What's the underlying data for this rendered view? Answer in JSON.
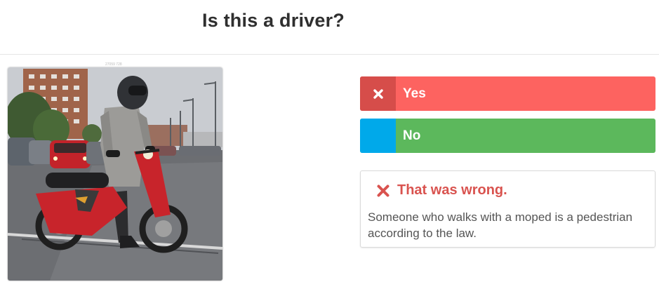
{
  "question": {
    "title": "Is this a driver?"
  },
  "photo": {
    "caption": "27059 728",
    "description": "person-with-helmet-next-to-red-moped"
  },
  "answers": [
    {
      "label": "Yes",
      "selected": true,
      "icon": "cross-icon",
      "color": "#fd6360",
      "marker_color": "#d64d4a"
    },
    {
      "label": "No",
      "selected": false,
      "icon": "none",
      "color": "#5cb85c",
      "marker_color": "#00a9ea"
    }
  ],
  "feedback": {
    "icon": "cross-icon",
    "title": "That was wrong.",
    "text": "Someone who walks with a moped is a pedestrian according to the law.",
    "color": "#d9534f"
  }
}
